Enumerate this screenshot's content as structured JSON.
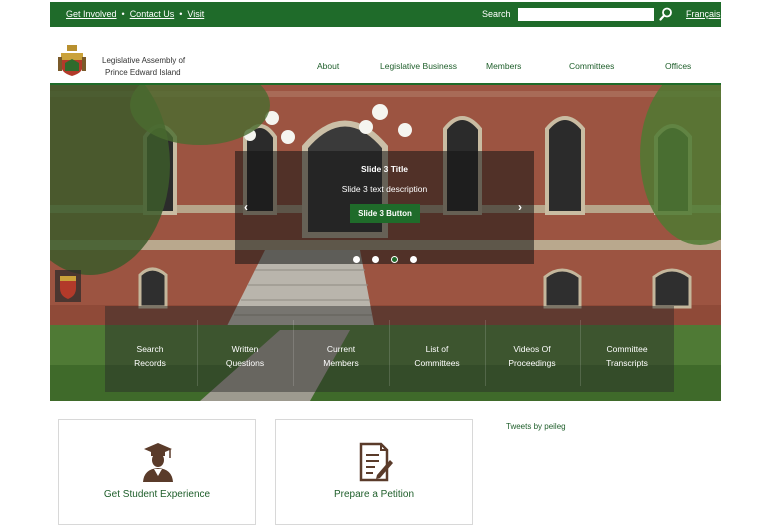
{
  "topbar": {
    "links": [
      "Get Involved",
      "Contact Us",
      "Visit"
    ],
    "search_label": "Search",
    "search_placeholder": "",
    "language": "Français"
  },
  "header": {
    "brand_line1": "Legislative Assembly of",
    "brand_line2": "Prince Edward Island",
    "nav": [
      "About",
      "Legislative Business",
      "Members",
      "Committees",
      "Offices"
    ]
  },
  "hero": {
    "slide_title": "Slide 3 Title",
    "slide_description": "Slide 3 text description",
    "slide_button": "Slide 3 Button",
    "prev_arrow": "‹",
    "next_arrow": "›",
    "slide_count": 4,
    "active_slide": 3
  },
  "quicklinks": [
    {
      "line1": "Search",
      "line2": "Records"
    },
    {
      "line1": "Written",
      "line2": "Questions"
    },
    {
      "line1": "Current",
      "line2": "Members"
    },
    {
      "line1": "List of",
      "line2": "Committees"
    },
    {
      "line1": "Videos Of",
      "line2": "Proceedings"
    },
    {
      "line1": "Committee",
      "line2": "Transcripts"
    }
  ],
  "cards": [
    {
      "label": "Get Student Experience",
      "icon": "graduate-icon"
    },
    {
      "label": "Prepare a Petition",
      "icon": "petition-icon"
    }
  ],
  "tweets_label": "Tweets by peileg",
  "colors": {
    "brand_green": "#1f6b2a",
    "icon_brown": "#5a3b2a"
  }
}
